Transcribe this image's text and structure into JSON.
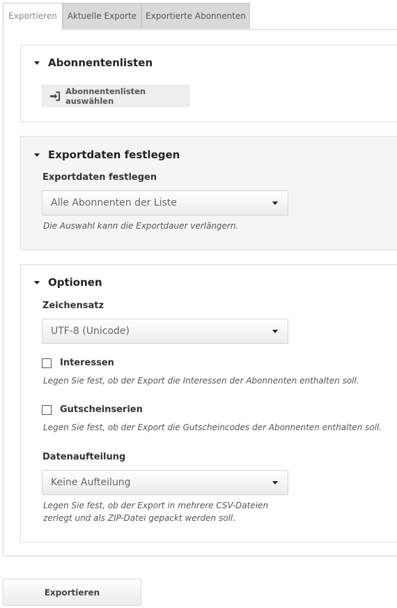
{
  "tabs": [
    {
      "label": "Exportieren",
      "active": true
    },
    {
      "label": "Aktuelle Exporte",
      "active": false
    },
    {
      "label": "Exportierte Abonnenten",
      "active": false
    }
  ],
  "sections": {
    "lists": {
      "title": "Abonnentenlisten",
      "choose_button": "Abonnentenlisten auswählen"
    },
    "export_data": {
      "title": "Exportdaten festlegen",
      "field_label": "Exportdaten festlegen",
      "select_value": "Alle Abonnenten der Liste",
      "hint": "Die Auswahl kann die Exportdauer verlängern."
    },
    "options": {
      "title": "Optionen",
      "charset_label": "Zeichensatz",
      "charset_value": "UTF-8 (Unicode)",
      "interests_label": "Interessen",
      "interests_checked": false,
      "interests_hint": "Legen Sie fest, ob der Export die Interessen der Abonnenten enthalten soll.",
      "coupons_label": "Gutscheinserien",
      "coupons_checked": false,
      "coupons_hint": "Legen Sie fest, ob der Export die Gutscheincodes der Abonnenten enthalten soll.",
      "split_label": "Datenaufteilung",
      "split_value": "Keine Aufteilung",
      "split_hint_line1": "Legen Sie fest, ob der Export in mehrere CSV-Dateien",
      "split_hint_line2": "zerlegt und als ZIP-Datei gepackt werden soll."
    }
  },
  "export_button": "Exportieren"
}
